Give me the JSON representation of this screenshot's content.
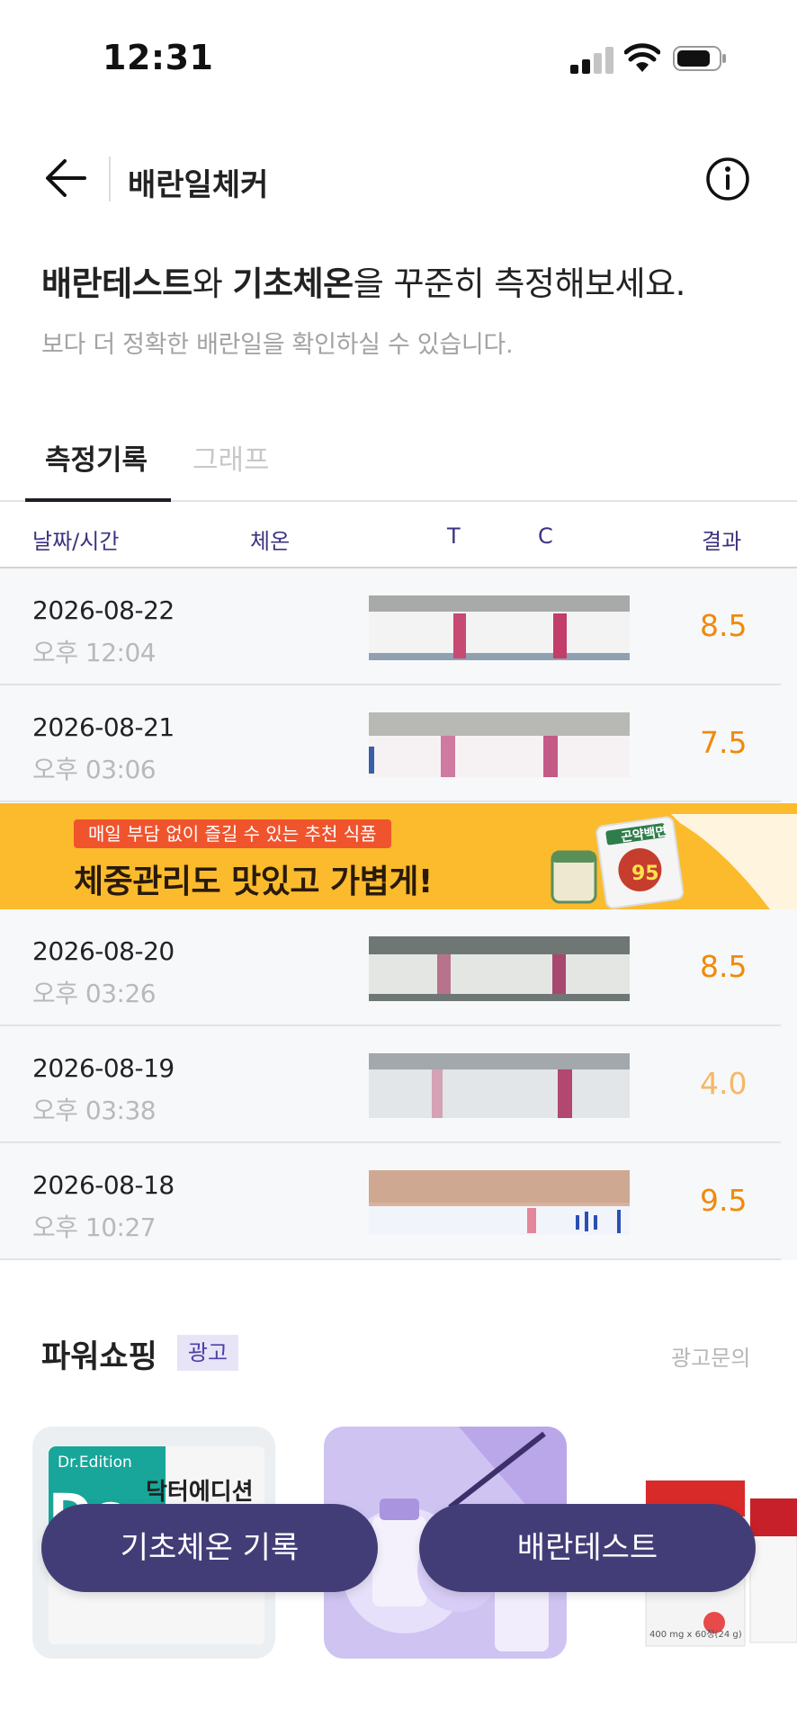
{
  "status_bar": {
    "time": "12:31"
  },
  "header": {
    "title": "배란일체커"
  },
  "intro": {
    "headline_parts": [
      "배란테스트",
      "와 ",
      "기초체온",
      "을 꾸준히 측정해보세요."
    ],
    "subtitle": "보다 더 정확한 배란일을 확인하실 수 있습니다."
  },
  "tabs": [
    {
      "label": "측정기록",
      "active": true
    },
    {
      "label": "그래프",
      "active": false
    }
  ],
  "table": {
    "columns": {
      "date": "날짜/시간",
      "temp": "체온",
      "t": "T",
      "c": "C",
      "result": "결과"
    },
    "rows": [
      {
        "date": "2026-08-22",
        "time": "오후 12:04",
        "result": "8.5"
      },
      {
        "date": "2026-08-21",
        "time": "오후 03:06",
        "result": "7.5"
      },
      {
        "date": "2026-08-20",
        "time": "오후 03:26",
        "result": "8.5"
      },
      {
        "date": "2026-08-19",
        "time": "오후 03:38",
        "result": "4.0"
      },
      {
        "date": "2026-08-18",
        "time": "오후 10:27",
        "result": "9.5"
      }
    ]
  },
  "banner": {
    "pill": "매일 부담 없이 즐길 수 있는 추천 식품",
    "title": "체중관리도 맛있고 가볍게!",
    "product_label": "곤약백면",
    "product_number": "95"
  },
  "power_shopping": {
    "title": "파워쇼핑",
    "badge": "광고",
    "inquiry": "광고문의",
    "cards": [
      {
        "brand": "Dr.Edition",
        "logo": "Dc",
        "name": "닥터에디션"
      },
      {
        "brand": ""
      },
      {
        "caption": "400 mg x 60정(24 g)"
      }
    ]
  },
  "cta": {
    "bbt": "기초체온 기록",
    "ovulation": "배란테스트"
  },
  "colors": {
    "accent": "#433d77",
    "result": "#f08a0c",
    "banner": "#fbbb2c"
  }
}
